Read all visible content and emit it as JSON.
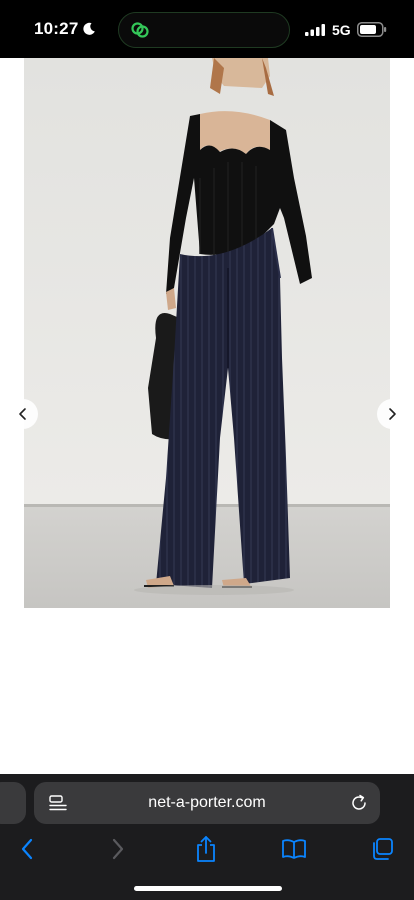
{
  "status_bar": {
    "time": "10:27",
    "network": "5G",
    "icons": [
      "moon-icon",
      "activity-link-icon",
      "signal-icon",
      "battery-icon"
    ]
  },
  "product": {
    "image": "model-in-black-knit-top-and-navy-pinstripe-trousers",
    "carousel": {
      "prev_icon": "chevron-left-icon",
      "next_icon": "chevron-right-icon"
    }
  },
  "browser": {
    "url": "net-a-porter.com",
    "toolbar": [
      "back-icon",
      "forward-icon",
      "share-icon",
      "bookmarks-icon",
      "tabs-icon"
    ],
    "accent_color": "#0a84ff",
    "disabled_color": "#5a5a5e"
  }
}
